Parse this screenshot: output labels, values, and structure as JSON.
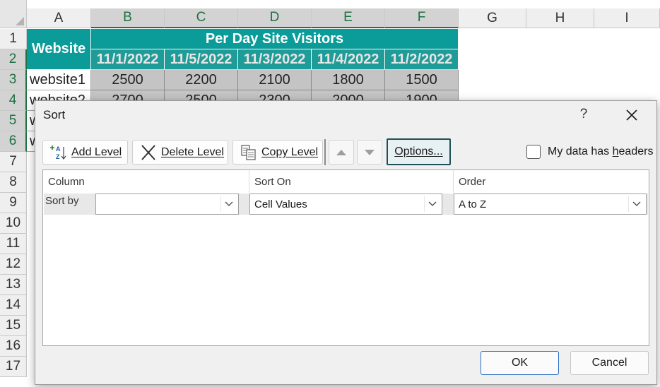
{
  "sheet": {
    "columns": [
      "A",
      "B",
      "C",
      "D",
      "E",
      "F",
      "G",
      "H",
      "I"
    ],
    "rows": [
      "1",
      "2",
      "3",
      "4",
      "5",
      "6",
      "7",
      "8",
      "9",
      "10",
      "11",
      "12",
      "13",
      "14",
      "15",
      "16",
      "17"
    ],
    "header_label": "Website",
    "title": "Per Day Site Visitors",
    "dates": [
      "11/1/2022",
      "11/5/2022",
      "11/3/2022",
      "11/4/2022",
      "11/2/2022"
    ],
    "data_rows": [
      {
        "site": "website1",
        "values": [
          "2500",
          "2200",
          "2100",
          "1800",
          "1500"
        ]
      },
      {
        "site": "website2",
        "values": [
          "2700",
          "2500",
          "2300",
          "2000",
          "1900"
        ]
      },
      {
        "site": "w",
        "values": []
      },
      {
        "site": "w",
        "values": []
      }
    ],
    "colors": {
      "teal": "#0b9b98",
      "grey": "#c4c4c4",
      "selected_header": "#217346"
    }
  },
  "dialog": {
    "title": "Sort",
    "help": "?",
    "toolbar": {
      "add_level": "Add Level",
      "delete_level": "Delete Level",
      "copy_level": "Copy Level",
      "options": "Options..."
    },
    "my_data_has_headers": "My data has headers",
    "my_data_has_headers_checked": false,
    "grid": {
      "headers": {
        "column": "Column",
        "sort_on": "Sort On",
        "order": "Order"
      },
      "rows": [
        {
          "label": "Sort by",
          "column": "",
          "sort_on": "Cell Values",
          "order": "A to Z"
        }
      ]
    },
    "ok": "OK",
    "cancel": "Cancel"
  }
}
